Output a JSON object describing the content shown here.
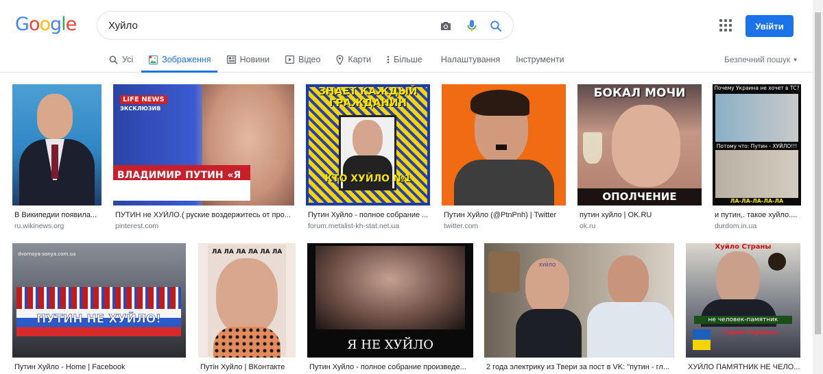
{
  "logo": [
    "G",
    "o",
    "o",
    "g",
    "l",
    "e"
  ],
  "search": {
    "query": "Хуйло"
  },
  "header": {
    "signin_label": "Увійти"
  },
  "tabs": [
    {
      "label": "Усі",
      "icon": "search-icon"
    },
    {
      "label": "Зображення",
      "icon": "image-icon",
      "active": true
    },
    {
      "label": "Новини",
      "icon": "news-icon"
    },
    {
      "label": "Відео",
      "icon": "video-icon"
    },
    {
      "label": "Карти",
      "icon": "map-pin-icon"
    },
    {
      "label": "Більше",
      "icon": "more-vert-icon"
    },
    {
      "label": "Налаштування"
    },
    {
      "label": "Інструменти"
    }
  ],
  "safe_search": {
    "label": "Безпечний пошук"
  },
  "colors": {
    "accent": "#1a73e8",
    "muted": "#70757a"
  },
  "results": [
    {
      "caption": "В Википедии появила...",
      "source": "ru.wikinews.org",
      "overlay": ""
    },
    {
      "caption": "ПУТИН не ХУЙЛО.( руские воздержитесь от про...",
      "source": "pinterest.com",
      "overlay": "ВЛАДИМИР ПУТИН «Я НЕ ХУЙЛО!»",
      "overlay_top": "LIFE NEWS",
      "overlay_sub": "ЭКСКЛЮЗИВ"
    },
    {
      "caption": "Путин Хуйло - полное собрание ...",
      "source": "forum.metalist-kh-stat.net.ua",
      "overlay": "ЗНАЕТ КАЖДЫЙ ГРАЖДАНИН",
      "overlay_bottom": "КТО ХУЙЛО №1"
    },
    {
      "caption": "Путин Хуйло (@PtnPnh) | Twitter",
      "source": "twitter.com",
      "overlay": ""
    },
    {
      "caption": "путин хуйло | OK.RU",
      "source": "ok.ru",
      "overlay": "БОКАЛ МОЧИ",
      "overlay_bottom": "ОПОЛЧЕНИЕ ДОНБАСС"
    },
    {
      "caption": "и путин,. такое хуйло....",
      "source": "durdom.in.ua",
      "overlay": "Почему Украина не хочет в ТС?",
      "overlay_mid": "Потому что: Путин - ХУЙЛО!!!",
      "overlay_bottom": "ЛА-ЛА-ЛА-ЛА-ЛА"
    },
    {
      "caption": "Путин Хуйло - Home | Facebook",
      "source": "",
      "overlay": "ПУТИН НЕ ХУЙЛО!",
      "overlay_top": "dvornaya-sonya.com.ua"
    },
    {
      "caption": "Путін Хуйло | ВКонтакте",
      "source": "",
      "overlay": "ЛА ЛА ЛА ЛА ЛА ЛА"
    },
    {
      "caption": "Путин Хуйло - полное собрание произведе...",
      "source": "",
      "overlay": "Я НЕ ХУЙЛО"
    },
    {
      "caption": "2 года электрику из Твери за пост в VK: \"путин - гл...",
      "source": "",
      "overlay": "ХУЙЛО"
    },
    {
      "caption": "ХУЙЛО ПАМЯТНИК НЕ ЧЕЛО...",
      "source": "",
      "overlay": "Хуйло Страны",
      "overlay_mid": "не человек-памятник",
      "overlay_bottom": "Герой Украины"
    }
  ]
}
